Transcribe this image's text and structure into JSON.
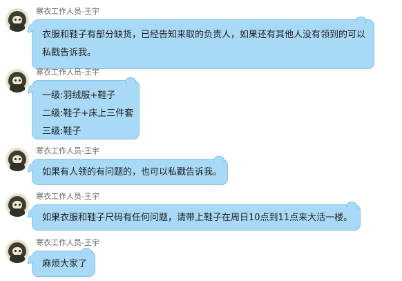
{
  "chat": {
    "messages": [
      {
        "sender": "寒衣工作人员-王宇",
        "lines": [
          "衣服和鞋子有部分缺货，已经告知来取的负责人，如果还有其他人没有领到的可以",
          "私戳告诉我。"
        ]
      },
      {
        "sender": "寒衣工作人员-王宇",
        "lines": [
          "一级:羽绒服+鞋子",
          "二级:鞋子+床上三件套",
          "三级:鞋子"
        ]
      },
      {
        "sender": "寒衣工作人员-王宇",
        "lines": [
          "如果有人领的有问题的，也可以私戳告诉我。"
        ]
      },
      {
        "sender": "寒衣工作人员-王宇",
        "lines": [
          "如果衣服和鞋子尺码有任何问题，请带上鞋子在周日10点到11点来大活一楼。"
        ]
      },
      {
        "sender": "寒衣工作人员-王宇",
        "lines": [
          "麻烦大家了"
        ]
      }
    ]
  },
  "colors": {
    "bubble_fill": "#a8d9f7",
    "bubble_border": "#86c2ea",
    "sender_text": "#666666"
  }
}
